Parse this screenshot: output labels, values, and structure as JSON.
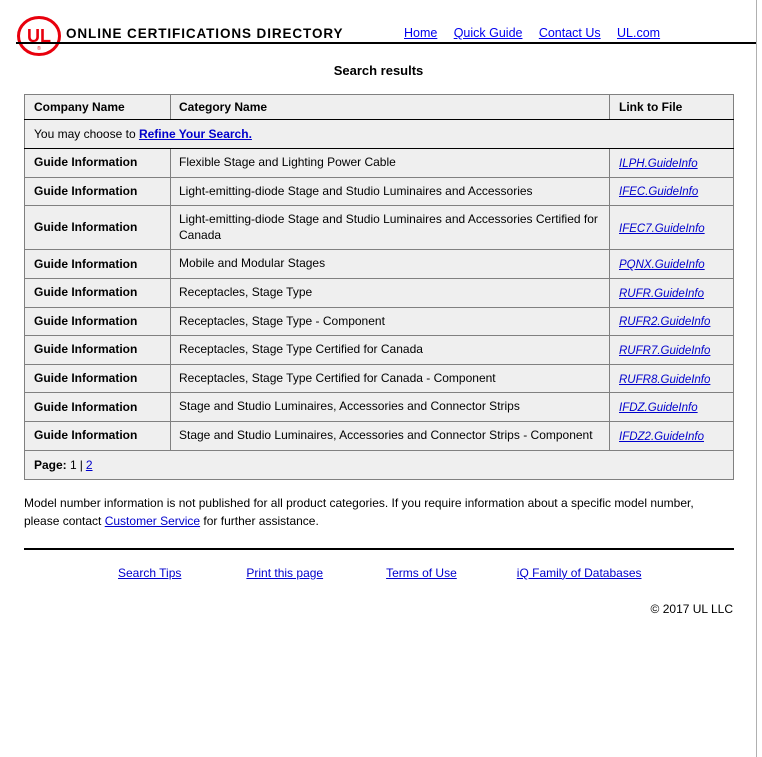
{
  "masthead": {
    "logo_alt": "UL",
    "logo_color": "#e8000d",
    "brand": "ONLINE CERTIFICATIONS DIRECTORY",
    "nav": [
      {
        "label": "Home"
      },
      {
        "label": "Quick Guide"
      },
      {
        "label": "Contact Us"
      },
      {
        "label": "UL.com"
      }
    ]
  },
  "page_title": "Search results",
  "refine": {
    "prefix": "You may choose to ",
    "link": "Refine Your Search."
  },
  "table": {
    "headers": {
      "company": "Company Name",
      "category": "Category Name",
      "link": "Link to File"
    },
    "rows": [
      {
        "company": "Guide Information",
        "category": "Flexible Stage and Lighting Power Cable",
        "link": "ILPH.GuideInfo"
      },
      {
        "company": "Guide Information",
        "category": "Light-emitting-diode Stage and Studio Luminaires and Accessories",
        "link": "IFEC.GuideInfo"
      },
      {
        "company": "Guide Information",
        "category": "Light-emitting-diode Stage and Studio Luminaires and Accessories Certified for Canada",
        "link": "IFEC7.GuideInfo"
      },
      {
        "company": "Guide Information",
        "category": "Mobile and Modular Stages",
        "link": "PQNX.GuideInfo"
      },
      {
        "company": "Guide Information",
        "category": "Receptacles, Stage Type",
        "link": "RUFR.GuideInfo"
      },
      {
        "company": "Guide Information",
        "category": "Receptacles, Stage Type - Component",
        "link": "RUFR2.GuideInfo"
      },
      {
        "company": "Guide Information",
        "category": "Receptacles, Stage Type Certified for Canada",
        "link": "RUFR7.GuideInfo"
      },
      {
        "company": "Guide Information",
        "category": "Receptacles, Stage Type Certified for Canada - Component",
        "link": "RUFR8.GuideInfo"
      },
      {
        "company": "Guide Information",
        "category": "Stage and Studio Luminaires, Accessories and Connector Strips",
        "link": "IFDZ.GuideInfo"
      },
      {
        "company": "Guide Information",
        "category": "Stage and Studio Luminaires, Accessories and Connector Strips - Component",
        "link": "IFDZ2.GuideInfo"
      }
    ]
  },
  "pager": {
    "label": "Page:",
    "current": "1",
    "separator": "|",
    "next_page": "2"
  },
  "disclaimer": {
    "part1": "Model number information is not published for all product categories. If you require information about a specific model number, please contact ",
    "link": "Customer Service",
    "part2": " for further assistance."
  },
  "footer": {
    "links": [
      {
        "label": "Search Tips"
      },
      {
        "label": "Print this page"
      },
      {
        "label": "Terms of Use"
      },
      {
        "label": "iQ Family of Databases"
      }
    ],
    "copyright": "© 2017 UL LLC"
  }
}
